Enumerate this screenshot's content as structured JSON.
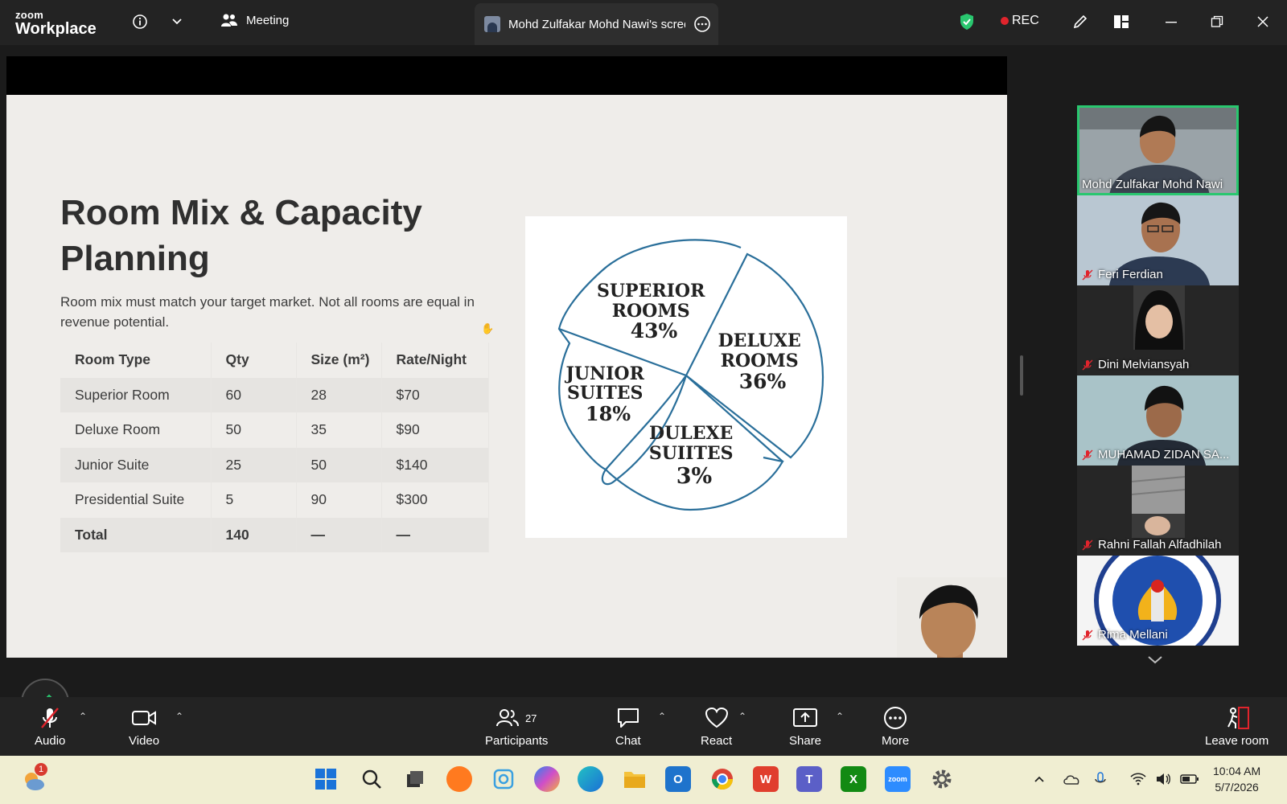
{
  "app": {
    "brand_small": "zoom",
    "brand_large": "Workplace"
  },
  "titlebar": {
    "meeting_label": "Meeting",
    "share_tab_title": "Mohd Zulfakar Mohd Nawi's screen",
    "rec_label": "REC"
  },
  "slide": {
    "title": "Room Mix & Capacity Planning",
    "subtitle": "Room mix must match your target market. Not all rooms are equal in revenue potential.",
    "table": {
      "headers": [
        "Room Type",
        "Qty",
        "Size (m²)",
        "Rate/Night"
      ],
      "rows": [
        [
          "Superior Room",
          "60",
          "28",
          "$70"
        ],
        [
          "Deluxe Room",
          "50",
          "35",
          "$90"
        ],
        [
          "Junior Suite",
          "25",
          "50",
          "$140"
        ],
        [
          "Presidential Suite",
          "5",
          "90",
          "$300"
        ]
      ],
      "total": [
        "Total",
        "140",
        "—",
        "—"
      ]
    },
    "pie": {
      "labels": [
        {
          "lines": [
            "SUPERIOR",
            "ROOMS",
            "43%"
          ]
        },
        {
          "lines": [
            "DELUXE",
            "ROOMS",
            "36%"
          ]
        },
        {
          "lines": [
            "JUNIOR",
            "SUITES",
            "18%"
          ]
        },
        {
          "lines": [
            "DULEXE",
            "SUIITES",
            "3%"
          ]
        }
      ]
    }
  },
  "gallery": {
    "participants": [
      {
        "name": "Mohd Zulfakar Mohd Nawi",
        "muted": false,
        "active": true,
        "bg": "#9aa3a8"
      },
      {
        "name": "Feri Ferdian",
        "muted": true,
        "active": false,
        "bg": "#b9c7d2"
      },
      {
        "name": "Dini Melviansyah",
        "muted": true,
        "active": false,
        "bg": "#2a2a2a"
      },
      {
        "name": "MUHAMAD ZIDAN SA...",
        "muted": true,
        "active": false,
        "bg": "#9fb7bd"
      },
      {
        "name": "Rahni Fallah Alfadhilah",
        "muted": true,
        "active": false,
        "bg": "#2a2a2a"
      },
      {
        "name": "Rima Mellani",
        "muted": true,
        "active": false,
        "bg": "#f2f2f2"
      }
    ]
  },
  "toolbar": {
    "audio": "Audio",
    "video": "Video",
    "participants": "Participants",
    "participants_count": "27",
    "chat": "Chat",
    "react": "React",
    "share": "Share",
    "more": "More",
    "leave": "Leave room"
  },
  "taskbar": {
    "weather_badge": "1",
    "time": "10:04 AM",
    "date": "5/7/2026",
    "zoom_label": "zoom"
  },
  "colors": {
    "accent_green": "#29c76f",
    "rec_red": "#e0242c",
    "pie_stroke": "#2a6f9a"
  }
}
